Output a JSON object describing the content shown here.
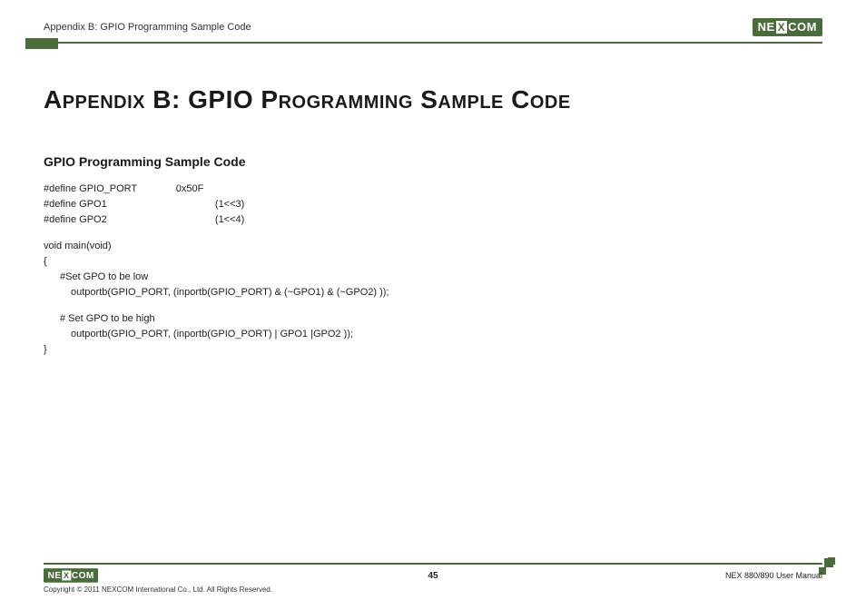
{
  "header": {
    "breadcrumb": "Appendix B: GPIO Programming Sample Code",
    "logo_left": "NE",
    "logo_x": "X",
    "logo_right": "COM"
  },
  "main": {
    "title": "Appendix B: GPIO Programming Sample Code",
    "section_heading": "GPIO Programming Sample Code",
    "code": {
      "l1": "#define GPIO_PORT              0x50F",
      "l2": "#define GPO1                                       (1<<3)",
      "l3": "#define GPO2                                       (1<<4)",
      "l4": "void main(void)",
      "l5": "{",
      "l6": "#Set GPO to be low",
      "l7": "outportb(GPIO_PORT, (inportb(GPIO_PORT) & (~GPO1) & (~GPO2) ));",
      "l8": "# Set GPO to be high",
      "l9": "outportb(GPIO_PORT, (inportb(GPIO_PORT) | GPO1 |GPO2 ));",
      "l10": "}"
    }
  },
  "footer": {
    "copyright": "Copyright © 2011 NEXCOM International Co., Ltd. All Rights Reserved.",
    "page_number": "45",
    "doc_ref": "NEX 880/890 User Manual"
  }
}
